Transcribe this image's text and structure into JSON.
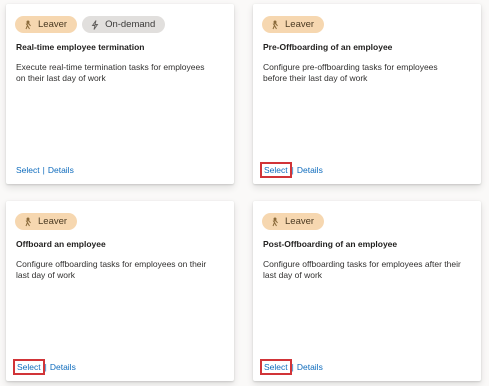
{
  "cards": [
    {
      "tags": [
        {
          "label": "Leaver",
          "icon": "person-leaving-icon",
          "color": "#f6d7b0"
        },
        {
          "label": "On-demand",
          "icon": "lightning-icon",
          "color": "#e1dfdd"
        }
      ],
      "title": "Real-time employee termination",
      "description": "Execute real-time termination tasks for employees on their last day of work",
      "select_label": "Select",
      "separator": "|",
      "details_label": "Details",
      "select_highlighted": false
    },
    {
      "tags": [
        {
          "label": "Leaver",
          "icon": "person-leaving-icon",
          "color": "#f6d7b0"
        }
      ],
      "title": "Pre-Offboarding of an employee",
      "description": "Configure pre-offboarding tasks for employees before their last day of work",
      "select_label": "Select",
      "separator": "|",
      "details_label": "Details",
      "select_highlighted": true
    },
    {
      "tags": [
        {
          "label": "Leaver",
          "icon": "person-leaving-icon",
          "color": "#f6d7b0"
        }
      ],
      "title": "Offboard an employee",
      "description": "Configure offboarding tasks for employees on their last day of work",
      "select_label": "Select",
      "separator": "|",
      "details_label": "Details",
      "select_highlighted": true
    },
    {
      "tags": [
        {
          "label": "Leaver",
          "icon": "person-leaving-icon",
          "color": "#f6d7b0"
        }
      ],
      "title": "Post-Offboarding of an employee",
      "description": "Configure offboarding tasks for employees after their last day of work",
      "select_label": "Select",
      "separator": "|",
      "details_label": "Details",
      "select_highlighted": true
    }
  ],
  "colors": {
    "link": "#0f6cbd",
    "highlight": "#d13438",
    "leaver_tag": "#f6d7b0",
    "ondemand_tag": "#e1dfdd"
  }
}
